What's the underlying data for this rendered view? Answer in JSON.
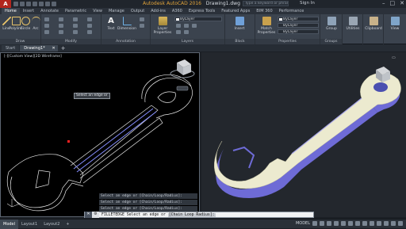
{
  "app": {
    "title": "Autodesk AutoCAD 2016",
    "document": "Drawing1.dwg",
    "app_button": "A"
  },
  "search": {
    "placeholder": "Type a keyword or phrase"
  },
  "account": {
    "sign_in": "Sign In"
  },
  "ribbon_tabs": [
    "Home",
    "Insert",
    "Annotate",
    "Parametric",
    "View",
    "Manage",
    "Output",
    "Add-ins",
    "A360",
    "Express Tools",
    "Featured Apps",
    "BIM 360",
    "Performance"
  ],
  "ribbon_active_tab": "Home",
  "ribbon": {
    "tools": {
      "line": "Line",
      "polyline": "Polyline",
      "circle": "Circle",
      "arc": "Arc",
      "text": "Text",
      "dimension": "Dimension",
      "layer_properties": "Layer Properties",
      "insert": "Insert",
      "match_properties": "Match Properties",
      "group": "Group",
      "utilities": "Utilities",
      "clipboard": "Clipboard",
      "view": "View"
    },
    "groups": {
      "draw": "Draw",
      "modify": "Modify",
      "annotation": "Annotation",
      "layers": "Layers",
      "block": "Block",
      "properties": "Properties",
      "groups": "Groups"
    },
    "properties": {
      "color": "ByLayer",
      "linetype": "ByLayer",
      "lineweight": "ByLayer"
    }
  },
  "file_tabs": [
    "Start",
    "Drawing1*"
  ],
  "file_tab_active": "Drawing1*",
  "viewport_label": "[-][Custom View][2D Wireframe]",
  "tooltip": "Select an edge or",
  "command_history": [
    "Select an edge or [Chain/Loop/Radius]:",
    "Select an edge or [Chain/Loop/Radius]:",
    "Select an edge or [Chain/Loop/Radius]:"
  ],
  "command_line": {
    "prefix": "FILLETEDGE Select an edge or",
    "options": "[Chain Loop Radius]:"
  },
  "layout_tabs": [
    "Model",
    "Layout1",
    "Layout2"
  ],
  "layout_active": "Model",
  "status": {
    "mode": "MODEL"
  },
  "colors": {
    "accent": "#e2a43a",
    "ribbon": "#3b434e",
    "model_face": "#ecebd2",
    "model_side": "#6d6ad9"
  }
}
